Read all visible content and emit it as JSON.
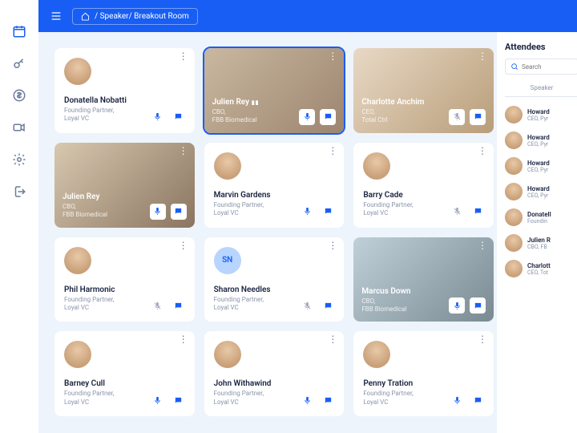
{
  "breadcrumb": "/ Speaker/ Breakout Room",
  "participants": [
    {
      "name": "Donatella Nobatti",
      "role": "Founding Partner,\nLoyal VC",
      "video": false,
      "muted": false,
      "initials": false
    },
    {
      "name": "Julien Rey",
      "role": "CBO,\nFBB Biomedical",
      "video": true,
      "muted": false,
      "active": true,
      "vbg": "video-bg vbg1"
    },
    {
      "name": "Charlotte Anchim",
      "role": "CEO,\nTotal Ctrl",
      "video": true,
      "muted": true,
      "vbg": "video-bg vbg2"
    },
    {
      "name": "Julien Rey",
      "role": "CBO,\nFBB Biomedical",
      "video": true,
      "muted": false,
      "vbg": "video-bg vbg3"
    },
    {
      "name": "Marvin Gardens",
      "role": "Founding Partner,\nLoyal VC",
      "video": false,
      "muted": false
    },
    {
      "name": "Barry Cade",
      "role": "Founding Partner,\nLoyal VC",
      "video": false,
      "muted": true
    },
    {
      "name": "Phil Harmonic",
      "role": "Founding Partner,\nLoyal VC",
      "video": false,
      "muted": true
    },
    {
      "name": "Sharon Needles",
      "role": "Founding Partner,\nLoyal VC",
      "video": false,
      "muted": true,
      "initials": "SN"
    },
    {
      "name": "Marcus Down",
      "role": "CBO,\nFBB Biomedical",
      "video": true,
      "muted": false,
      "vbg": "video-bg vbg4"
    },
    {
      "name": "Barney Cull",
      "role": "Founding Partner,\nLoyal VC",
      "video": false,
      "muted": false
    },
    {
      "name": "John Withawind",
      "role": "Founding Partner,\nLoyal VC",
      "video": false,
      "muted": false
    },
    {
      "name": "Penny Tration",
      "role": "Founding Partner,\nLoyal VC",
      "video": false,
      "muted": false
    }
  ],
  "sidebar": {
    "title": "Attendees",
    "search_placeholder": "Search",
    "tab": "Speaker",
    "list": [
      {
        "name": "Howard",
        "role": "CEO, Pyr"
      },
      {
        "name": "Howard",
        "role": "CEO, Pyr"
      },
      {
        "name": "Howard",
        "role": "CEO, Pyr"
      },
      {
        "name": "Howard",
        "role": "CEO, Pyr"
      },
      {
        "name": "Donatell",
        "role": "Foundin"
      },
      {
        "name": "Julien R",
        "role": "CBO, FB"
      },
      {
        "name": "Charlott",
        "role": "CEO, Tot"
      }
    ]
  }
}
